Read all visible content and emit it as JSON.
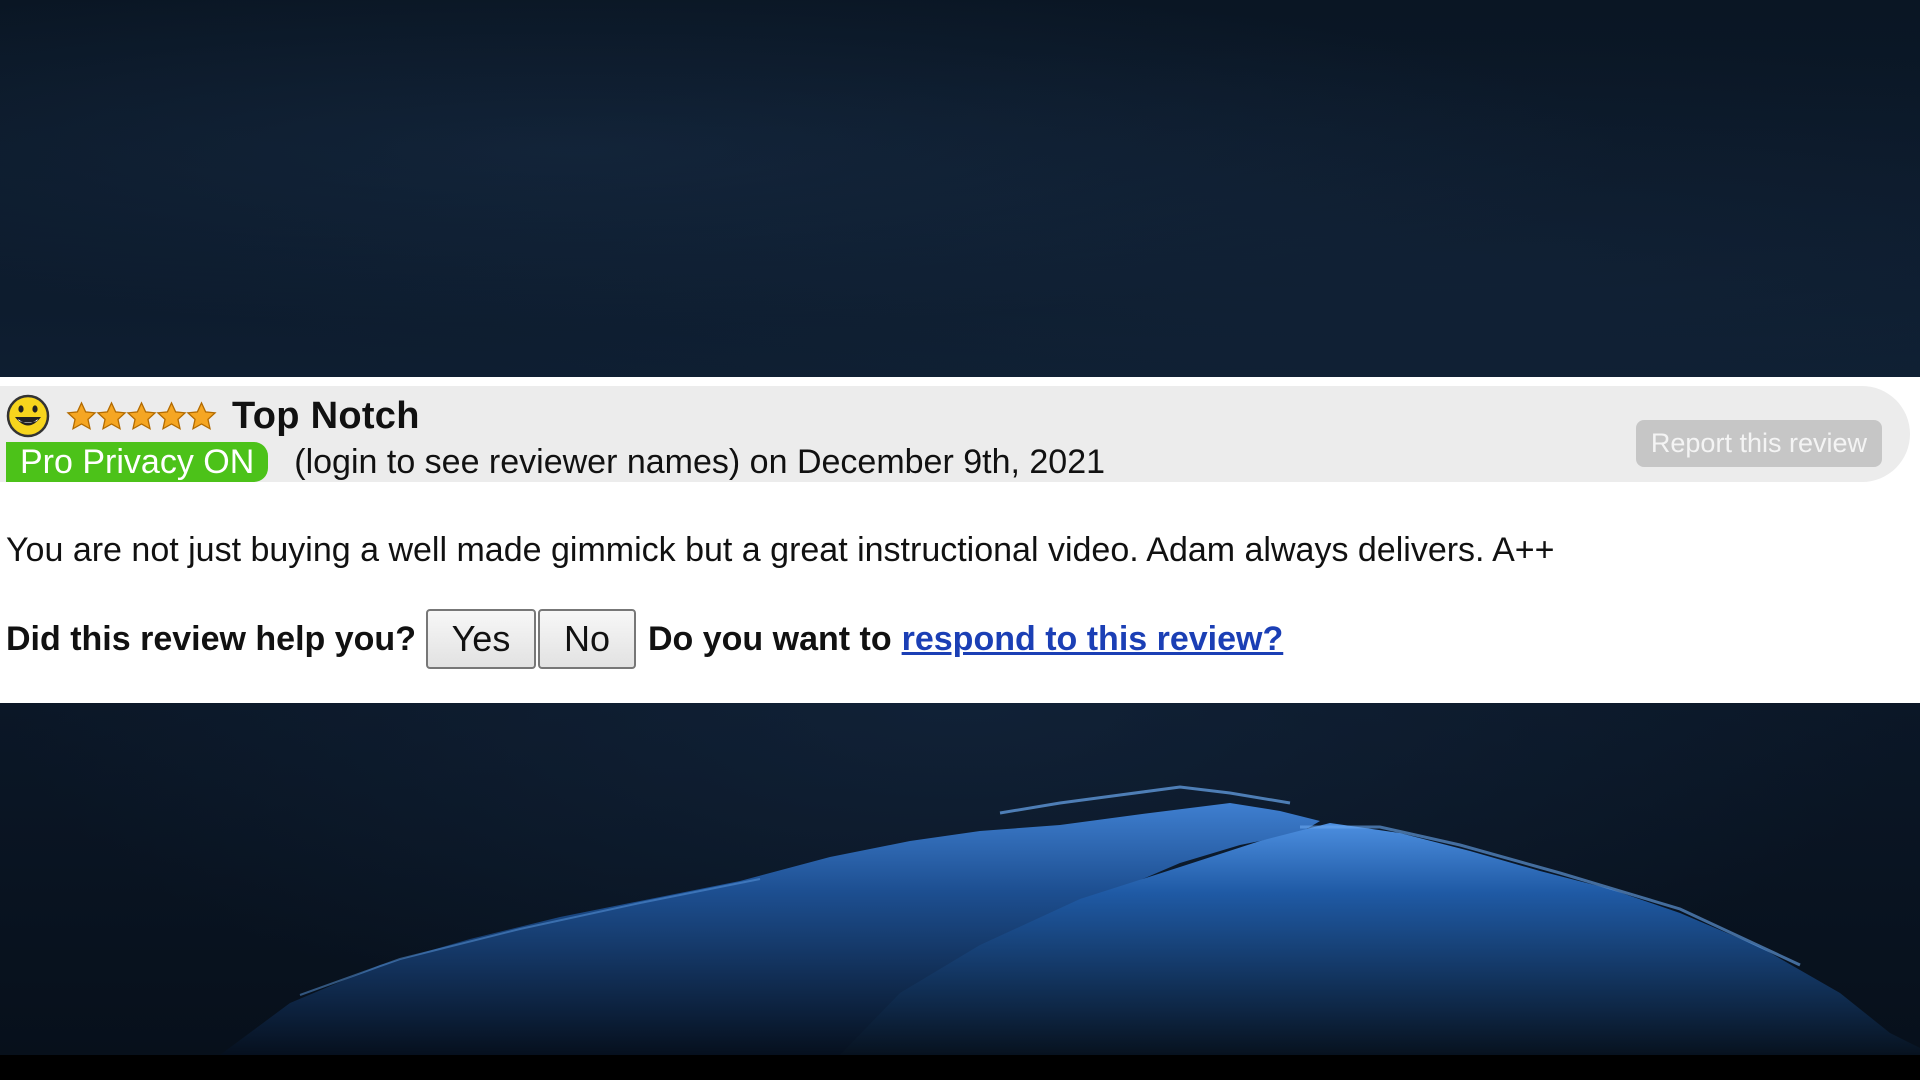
{
  "review": {
    "title": "Top Notch",
    "rating": {
      "value": 5,
      "max": 5,
      "star_color": "#f5a623",
      "icon": "star-icon"
    },
    "reviewer_icon": "smiley-face-icon",
    "privacy_badge": "Pro Privacy ON",
    "privacy_badge_color": "#4cc219",
    "meta_text": "(login to see reviewer names) on December 9th, 2021",
    "report_button": "Report this review",
    "body": "You are not just buying a well made gimmick but a great instructional video. Adam always delivers. A++"
  },
  "helpfulness": {
    "question": "Did this review help you?",
    "yes_label": "Yes",
    "no_label": "No",
    "respond_prompt": "Do you want to",
    "respond_link": "respond to this review?",
    "link_color": "#1b3fb5"
  }
}
